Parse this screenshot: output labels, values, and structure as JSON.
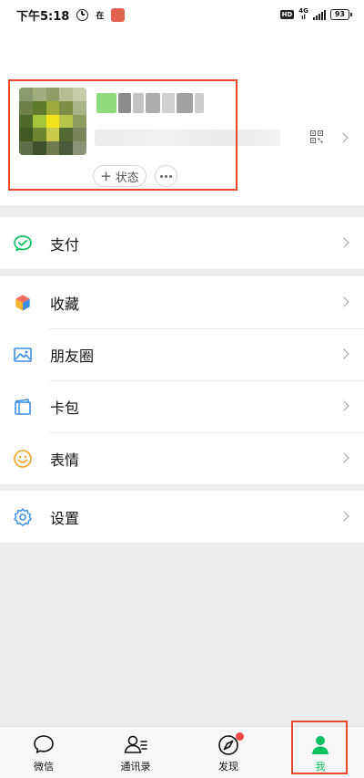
{
  "status_bar": {
    "time": "下午5:18",
    "mini_label": "在",
    "hd": "HD",
    "net_type": "4G",
    "net_sub": "ıl",
    "battery": "93"
  },
  "profile": {
    "status_label": "状态",
    "status_plus": "+"
  },
  "menu": {
    "pay": "支付",
    "favorites": "收藏",
    "moments": "朋友圈",
    "cards": "卡包",
    "stickers": "表情",
    "settings": "设置"
  },
  "tabs": {
    "chats": "微信",
    "contacts": "通讯录",
    "discover": "发现",
    "me": "我"
  },
  "colors": {
    "accent_green": "#07c160",
    "highlight_red": "#e8492b"
  }
}
